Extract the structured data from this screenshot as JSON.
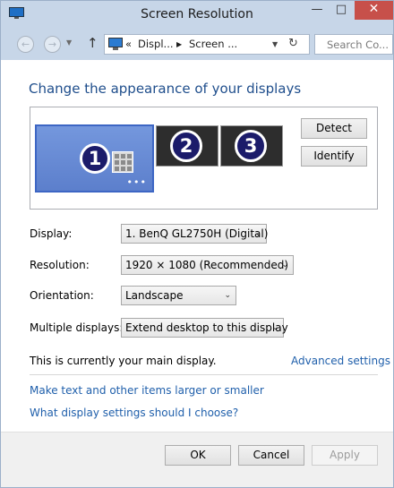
{
  "window": {
    "title": "Screen Resolution",
    "controls": {
      "minimize": "—",
      "maximize": "□",
      "close": "✕"
    }
  },
  "nav": {
    "back_glyph": "←",
    "forward_glyph": "→",
    "recent_glyph": "▼",
    "up_glyph": "↑",
    "address": {
      "chevron": "«",
      "segment1": "Displ...",
      "separator": "▶",
      "segment2": "Screen ...",
      "dropdown": "▼",
      "refresh": "↻"
    },
    "search_placeholder": "Search Co..."
  },
  "heading": "Change the appearance of your displays",
  "monitors": [
    {
      "number": "1",
      "selected": true
    },
    {
      "number": "2",
      "selected": false
    },
    {
      "number": "3",
      "selected": false
    }
  ],
  "monitor_taskbar_dots": "•••",
  "buttons": {
    "detect": "Detect",
    "identify": "Identify",
    "ok": "OK",
    "cancel": "Cancel",
    "apply": "Apply"
  },
  "settings": {
    "display": {
      "label": "Display:",
      "value": "1. BenQ GL2750H (Digital)"
    },
    "resolution": {
      "label": "Resolution:",
      "value": "1920 × 1080 (Recommended)"
    },
    "orientation": {
      "label": "Orientation:",
      "value": "Landscape"
    },
    "multiple_displays": {
      "label": "Multiple displays:",
      "value": "Extend desktop to this display"
    }
  },
  "status_text": "This is currently your main display.",
  "links": {
    "advanced": "Advanced settings",
    "text_size": "Make text and other items larger or smaller",
    "which_settings": "What display settings should I choose?"
  },
  "dropdown_arrow": "⌄",
  "colors": {
    "accent": "#1f4e8c",
    "link": "#1f5fab",
    "selected_monitor": "#6b8cd4",
    "inactive_monitor": "#2d2d2d",
    "titlebar": "#c7d6e8"
  },
  "icons": [
    "monitor-icon",
    "back-icon",
    "forward-icon",
    "up-arrow-icon",
    "refresh-icon",
    "search-icon"
  ]
}
